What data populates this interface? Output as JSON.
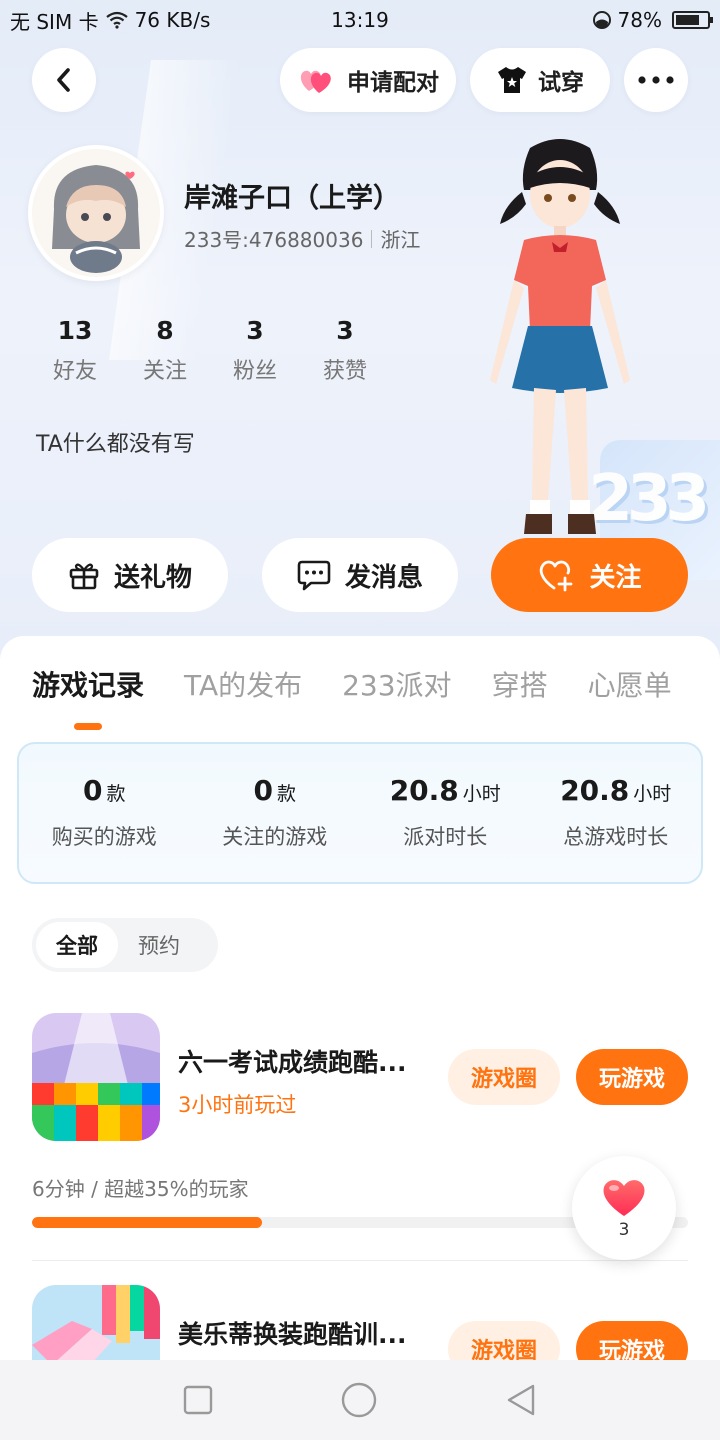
{
  "status_bar": {
    "carrier": "无 SIM 卡",
    "speed": "76 KB/s",
    "time": "13:19",
    "battery": "78%",
    "battery_level": 0.78
  },
  "header": {
    "back_icon": "chevron-left-icon",
    "match_label": "申请配对",
    "try_label": "试穿",
    "more_icon": "more-dots-icon"
  },
  "profile": {
    "nickname": "岸滩子口（上学）",
    "id_text": "233号:476880036",
    "region": "浙江",
    "bio": "TA什么都没有写",
    "stats": [
      {
        "num": "13",
        "label": "好友"
      },
      {
        "num": "8",
        "label": "关注"
      },
      {
        "num": "3",
        "label": "粉丝"
      },
      {
        "num": "3",
        "label": "获赞"
      }
    ]
  },
  "actions": {
    "gift_label": "送礼物",
    "message_label": "发消息",
    "follow_label": "关注"
  },
  "tabs": [
    "游戏记录",
    "TA的发布",
    "233派对",
    "穿搭",
    "心愿单"
  ],
  "summary": [
    {
      "value": "0",
      "unit": "款",
      "label": "购买的游戏"
    },
    {
      "value": "0",
      "unit": "款",
      "label": "关注的游戏"
    },
    {
      "value": "20.8",
      "unit": "小时",
      "label": "派对时长"
    },
    {
      "value": "20.8",
      "unit": "小时",
      "label": "总游戏时长"
    }
  ],
  "filter": {
    "all_label": "全部",
    "reserve_label": "预约"
  },
  "games": [
    {
      "title": "六一考试成绩跑酷...",
      "last_played": "3小时前玩过",
      "circle_label": "游戏圈",
      "play_label": "玩游戏",
      "progress_text": "6分钟 / 超越35%的玩家",
      "progress": 0.35
    },
    {
      "title": "美乐蒂换装跑酷训...",
      "circle_label": "游戏圈",
      "play_label": "玩游戏"
    }
  ],
  "like_float": {
    "count": "3"
  },
  "colors": {
    "accent": "#ff7310",
    "accent_light": "#fff0e3",
    "summary_border": "#cfe7f7"
  }
}
